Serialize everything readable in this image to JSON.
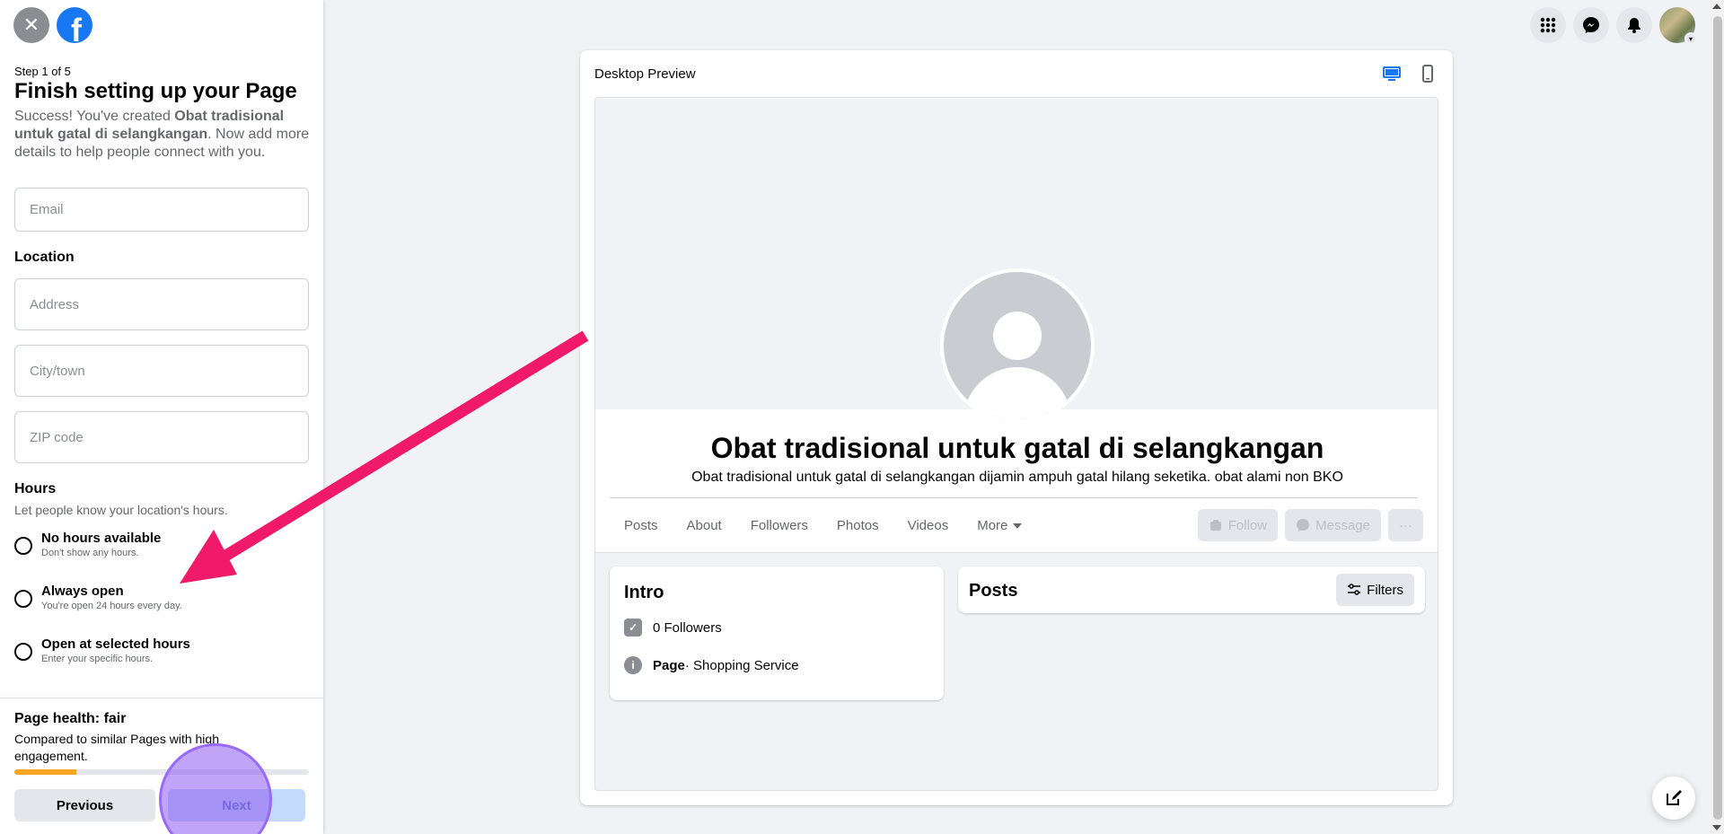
{
  "left_panel": {
    "step_label": "Step 1 of 5",
    "title": "Finish setting up your Page",
    "desc_prefix": "Success! You've created ",
    "page_name_bold": "Obat tradisional untuk gatal di selangkangan",
    "desc_suffix": ". Now add more details to help people connect with you.",
    "email_placeholder": "Email",
    "location_title": "Location",
    "address_placeholder": "Address",
    "city_placeholder": "City/town",
    "zip_placeholder": "ZIP code",
    "hours_title": "Hours",
    "hours_sub": "Let people know your location's hours.",
    "hours_options": [
      {
        "label": "No hours available",
        "hint": "Don't show any hours."
      },
      {
        "label": "Always open",
        "hint": "You're open 24 hours every day."
      },
      {
        "label": "Open at selected hours",
        "hint": "Enter your specific hours."
      }
    ],
    "health_title": "Page health: fair",
    "health_desc": "Compared to similar Pages with high engagement.",
    "health_progress": 0.21,
    "prev_label": "Previous",
    "next_label": "Next"
  },
  "preview": {
    "title": "Desktop Preview",
    "page_name": "Obat tradisional untuk gatal di selangkangan",
    "page_desc": "Obat tradisional untuk gatal di selangkangan dijamin ampuh gatal hilang seketika. obat alami non BKO",
    "tabs": [
      "Posts",
      "About",
      "Followers",
      "Photos",
      "Videos",
      "More"
    ],
    "follow_label": "Follow",
    "message_label": "Message",
    "more_label": "···",
    "intro_title": "Intro",
    "followers_text": "0 Followers",
    "page_type_bold": "Page",
    "page_type_rest": " · Shopping Service",
    "posts_title": "Posts",
    "filters_label": "Filters"
  },
  "colors": {
    "accent": "#1877f2",
    "arrow": "#f0196a",
    "click_marker": "#8c5af0",
    "health": "#f5a623"
  },
  "icons": {
    "close": "close-icon",
    "logo": "facebook-logo-icon",
    "menu": "grid-menu-icon",
    "messenger": "messenger-icon",
    "notifications": "bell-icon",
    "desktop": "desktop-icon",
    "mobile": "mobile-icon",
    "compose": "compose-icon"
  }
}
